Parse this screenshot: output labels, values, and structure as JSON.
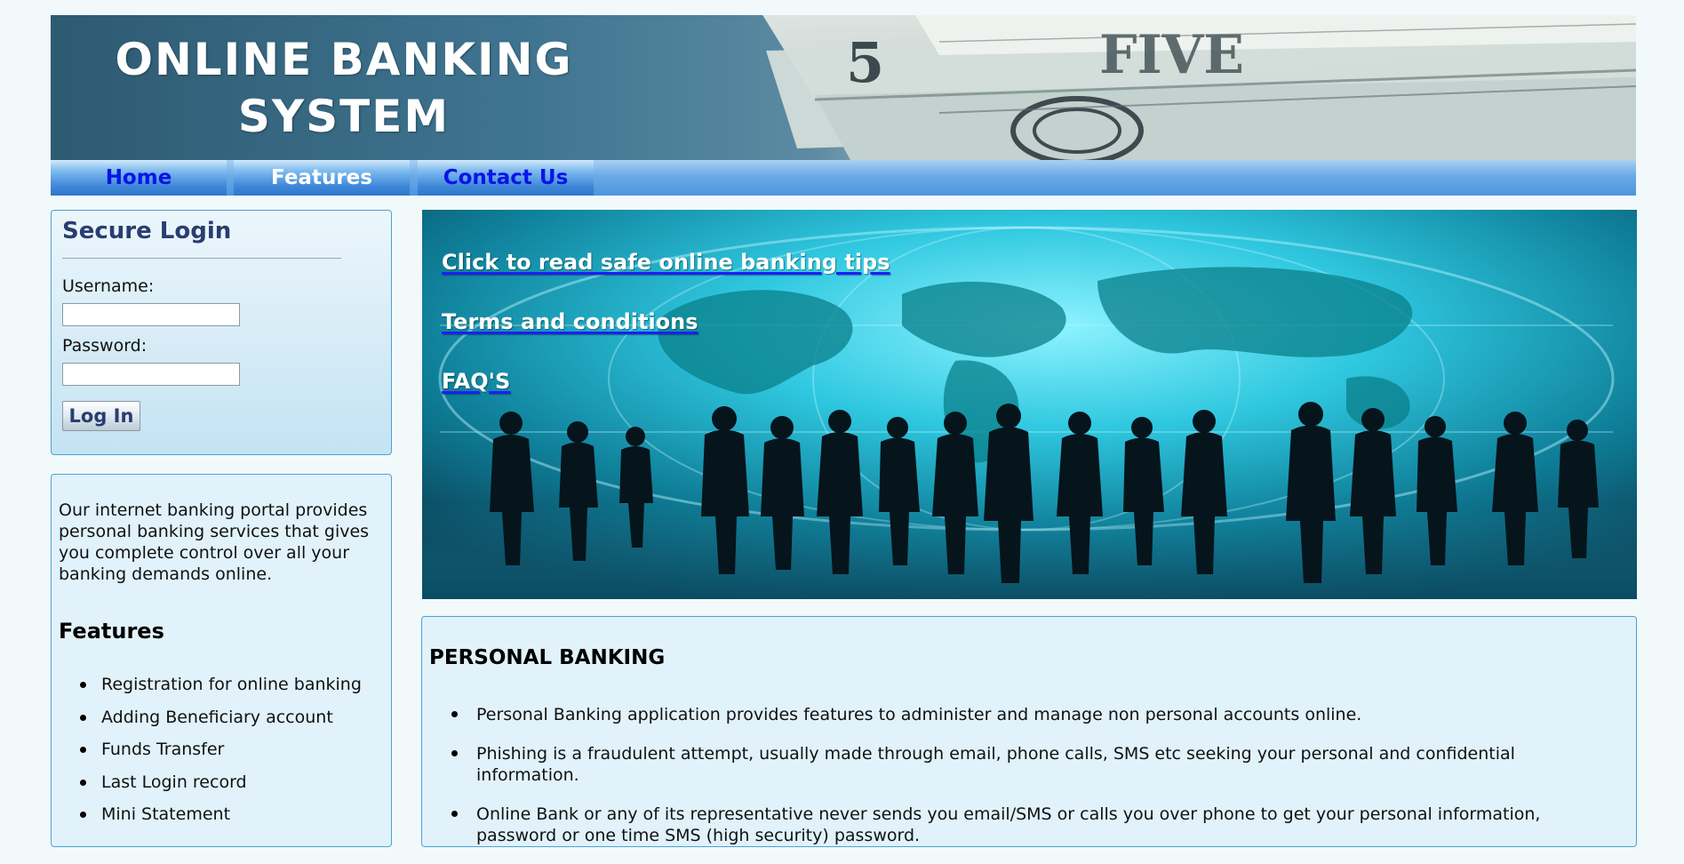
{
  "header": {
    "title_line1": "ONLINE BANKING",
    "title_line2": "SYSTEM"
  },
  "nav": {
    "items": [
      {
        "label": "Home"
      },
      {
        "label": "Features"
      },
      {
        "label": "Contact Us"
      }
    ]
  },
  "login": {
    "title": "Secure Login",
    "username_label": "Username:",
    "username_value": "",
    "password_label": "Password:",
    "password_value": "",
    "button_label": "Log In"
  },
  "sidebar": {
    "intro": "Our internet banking portal provides personal banking services that gives you complete control over all your banking demands online.",
    "features_heading": "Features",
    "features": [
      "Registration for online banking",
      "Adding Beneficiary account",
      "Funds Transfer",
      "Last Login record",
      "Mini Statement"
    ]
  },
  "hero": {
    "links": [
      "Click to read safe online banking tips",
      "Terms and conditions",
      "FAQ'S"
    ]
  },
  "personal_banking": {
    "title": "PERSONAL BANKING",
    "items": [
      "Personal Banking application provides features to administer and manage non personal accounts online.",
      "Phishing is a fraudulent attempt, usually made through email, phone calls, SMS etc seeking your personal and confidential information.",
      "Online Bank or any of its representative never sends you email/SMS or calls you over phone to get your personal information, password or one time SMS (high security) password."
    ]
  },
  "colors": {
    "nav_link_active": "#0a14e6",
    "nav_link_highlight": "#ffffff",
    "login_title": "#283d70",
    "panel_border": "#4aa3d6",
    "panel_bg": "#e1f2fa"
  }
}
